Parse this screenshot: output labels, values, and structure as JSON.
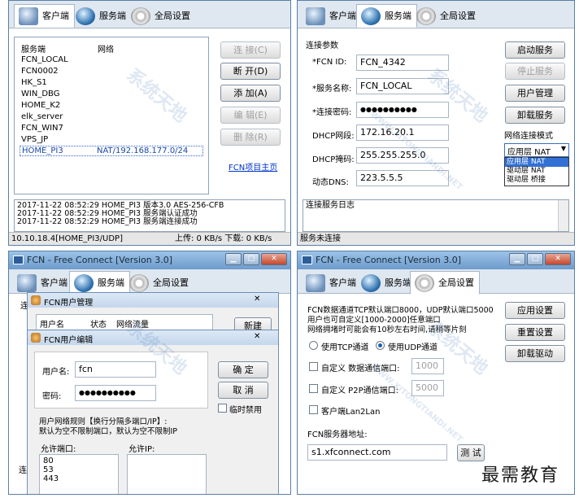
{
  "window_title": "FCN - Free Connect [Version 3.0]",
  "tabs": {
    "client": "客户端",
    "server": "服务端",
    "settings": "全局设置"
  },
  "panel1": {
    "col_service": "服务端",
    "col_network": "网络",
    "servers": [
      "FCN_LOCAL",
      "FCN0002",
      "HK_S1",
      "WIN_DBG",
      "HOME_K2",
      "elk_server",
      "FCN_WIN7",
      "VPS_JP"
    ],
    "selected_name": "HOME_PI3",
    "selected_network": "NAT/192.168.177.0/24",
    "btn_connect": "连 接(C)",
    "btn_disconnect": "断 开(D)",
    "btn_add": "添 加(A)",
    "btn_edit": "编 辑(E)",
    "btn_delete": "删 除(R)",
    "homepage_link": "FCN项目主页",
    "log": [
      "2017-11-22 08:52:29 HOME_PI3 版本3.0 AES-256-CFB",
      "2017-11-22 08:52:29 HOME_PI3 服务端认证成功",
      "2017-11-22 08:52:29 HOME_PI3 服务端连接成功"
    ],
    "status_left": "10.10.18.4[HOME_PI3/UDP]",
    "status_right": "上传: 0  KB/s 下载: 0  KB/s"
  },
  "panel2": {
    "group": "连接参数",
    "fcn_id_label": "*FCN ID:",
    "fcn_id": "FCN_4342",
    "service_name_label": "*服务名称:",
    "service_name": "FCN_LOCAL",
    "password_label": "*连接密码:",
    "password": "●●●●●●●●●●",
    "dhcp_net_label": "DHCP网段:",
    "dhcp_net": "172.16.20.1",
    "dhcp_mask_label": "DHCP掩码:",
    "dhcp_mask": "255.255.255.0",
    "dns_label": "动态DNS:",
    "dns": "223.5.5.5",
    "btn_start": "启动服务",
    "btn_stop": "停止服务",
    "btn_users": "用户管理",
    "btn_uninstall": "卸载服务",
    "mode_label": "网络连接模式",
    "mode_selected": "应用层 NAT",
    "mode_options": [
      "应用层 NAT",
      "驱动层 NAT",
      "驱动层 桥接"
    ],
    "log_title": "连接服务日志",
    "status": "服务未连接"
  },
  "panel3": {
    "dialog1_title": "FCN用户管理",
    "col_user": "用户名",
    "col_state": "状态",
    "col_traffic": "网络流量",
    "btn_new": "新建",
    "dialog2_title": "FCN用户编辑",
    "username_label": "用户名:",
    "username": "fcn",
    "password_label": "密码:",
    "password": "●●●●●●●●●●",
    "btn_ok": "确 定",
    "btn_cancel": "取 消",
    "temp_disable": "临时禁用",
    "rule_text_1": "用户网络规则【换行分隔多端口/IP】:",
    "rule_text_2": "默认为空不限制端口，默认为空不限制IP",
    "ports_label": "允许端口:",
    "ips_label": "允许IP:",
    "ports": [
      "80",
      "53",
      "443"
    ],
    "partial_bg_1": "连",
    "partial_bg_2": "连"
  },
  "panel4": {
    "desc_1": "FCN数据通道TCP默认端口8000，UDP默认端口5000",
    "desc_2": "用户也可自定义[1000-2000]任意端口",
    "desc_3": "网络拥堵时可能会有10秒左右时间,请稍等片刻",
    "tcp_label": "使用TCP通道",
    "udp_label": "使用UDP通道",
    "custom1_label": "自定义  数据通信端口:",
    "custom1_value": "1000",
    "custom2_label": "自定义  P2P通信端口:",
    "custom2_value": "5000",
    "lan_label": "客户端Lan2Lan",
    "server_addr_label": "FCN服务器地址:",
    "server_addr": "s1.xfconnect.com",
    "btn_test": "测 试",
    "btn_apply": "应用设置",
    "btn_reset": "重置设置",
    "btn_uninstall": "卸载驱动"
  },
  "watermark": "系统天地",
  "watermark_url": "WWW.XITONGTIANDI.NET",
  "brand": "最需教育"
}
